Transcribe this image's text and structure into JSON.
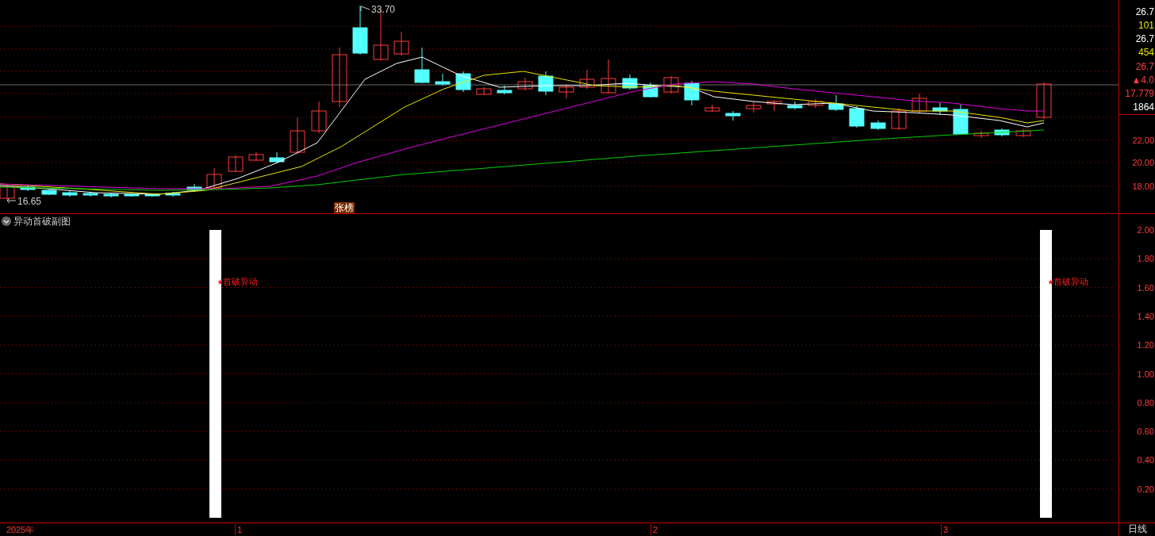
{
  "price_panel": {
    "high_label": "33.70",
    "low_label": "16.65",
    "event_tag": "张榜",
    "quote_readouts": [
      {
        "text": "26.7",
        "color": "#ffffff"
      },
      {
        "text": "101",
        "color": "#e6e600"
      },
      {
        "text": "26.7",
        "color": "#ffffff"
      },
      {
        "text": "454",
        "color": "#e6e600"
      },
      {
        "text": "26.7",
        "color": "#ff3b3b"
      },
      {
        "text": "▲4.0",
        "color": "#ff3b3b"
      },
      {
        "text": "17.779",
        "color": "#ff3b3b"
      },
      {
        "text": "1864",
        "color": "#ffffff"
      }
    ],
    "axis_ticks": [
      "22.00",
      "20.00",
      "18.00"
    ]
  },
  "indicator_panel": {
    "title": "异动首破副图",
    "signals": [
      "首破异动",
      "首破异动"
    ],
    "axis_ticks": [
      "2.00",
      "1.80",
      "1.60",
      "1.40",
      "1.20",
      "1.00",
      "0.80",
      "0.60",
      "0.40",
      "0.20"
    ]
  },
  "time_axis": {
    "labels": [
      "2025年",
      "1",
      "2",
      "3"
    ],
    "period": "日线"
  }
}
